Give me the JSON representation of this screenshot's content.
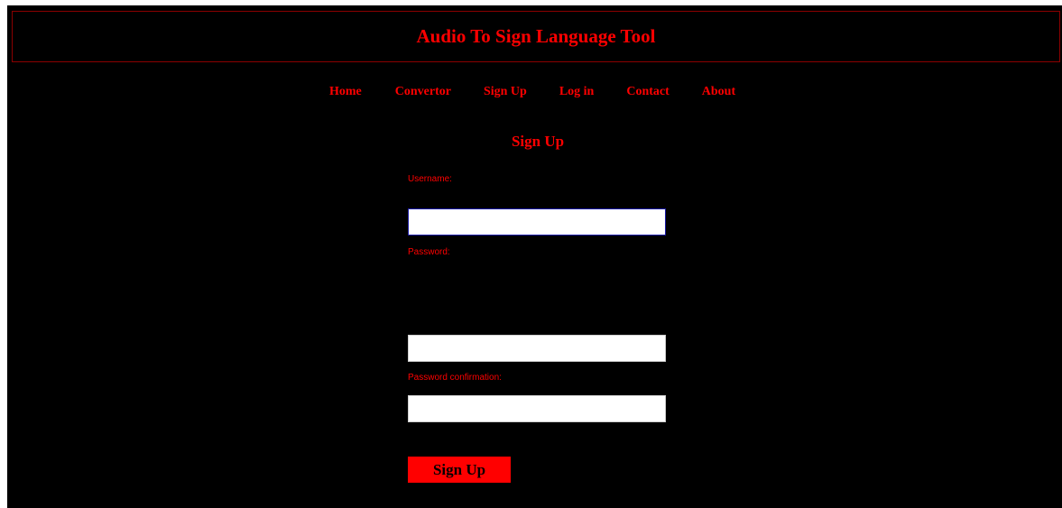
{
  "header": {
    "title": "Audio To Sign Language Tool"
  },
  "nav": {
    "items": [
      {
        "label": "Home"
      },
      {
        "label": "Convertor"
      },
      {
        "label": "Sign Up"
      },
      {
        "label": "Log in"
      },
      {
        "label": "Contact"
      },
      {
        "label": "About"
      }
    ]
  },
  "form": {
    "title": "Sign Up",
    "username_label": "Username:",
    "username_value": "",
    "password_label": "Password:",
    "password_value": "",
    "password_confirm_label": "Password confirmation:",
    "password_confirm_value": "",
    "submit_label": "Sign Up"
  },
  "colors": {
    "background": "#000000",
    "accent": "#ff0000",
    "header_border": "#8b0000",
    "focus_border": "#1a1aa6"
  }
}
